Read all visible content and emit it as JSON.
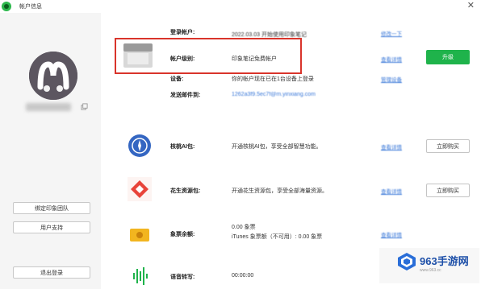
{
  "window": {
    "title": "帐户信息",
    "close_glyph": "✕"
  },
  "sidebar": {
    "username": "",
    "buttons": {
      "team": "绑定印象团队",
      "support": "用户支持",
      "logout": "退出登录"
    }
  },
  "account": {
    "login_label": "登录帐户:",
    "login_value": "2022.03.03 开始使用印象笔记",
    "login_link": "修改一下",
    "level_label": "帐户级别:",
    "level_value": "印象笔记免费帐户",
    "level_link": "查看详情",
    "upgrade_button": "升级",
    "device_label": "设备:",
    "device_value": "你的帐户现在已在1台设备上登录",
    "device_link": "管理设备",
    "email_label": "发送邮件到:",
    "email_value": "1262a3f9.5ec7f@m.yinxiang.com"
  },
  "features": [
    {
      "icon": "compass-icon",
      "label": "核桃AI包:",
      "value": "开通核桃AI包，享受全部智慧功能。",
      "link": "查看详情",
      "button": "立即购买"
    },
    {
      "icon": "red-packet-icon",
      "label": "花生资源包:",
      "value": "开通花生资源包，享受全部海量资源。",
      "link": "查看详情",
      "button": "立即购买"
    },
    {
      "icon": "coin-icon",
      "label": "象票余额:",
      "value_line1": "0.00 象票",
      "value_line2": "iTunes 象票额（不可用）: 0.00 象票",
      "link": "查看详情"
    },
    {
      "icon": "voice-icon",
      "label": "语音转写:",
      "value": "00:00:00"
    }
  ],
  "watermark": {
    "text": "963手游网",
    "sub": "www.963.cc"
  },
  "colors": {
    "accent": "#1fb34b",
    "highlight": "#d9342b",
    "link": "#3a78d8"
  }
}
